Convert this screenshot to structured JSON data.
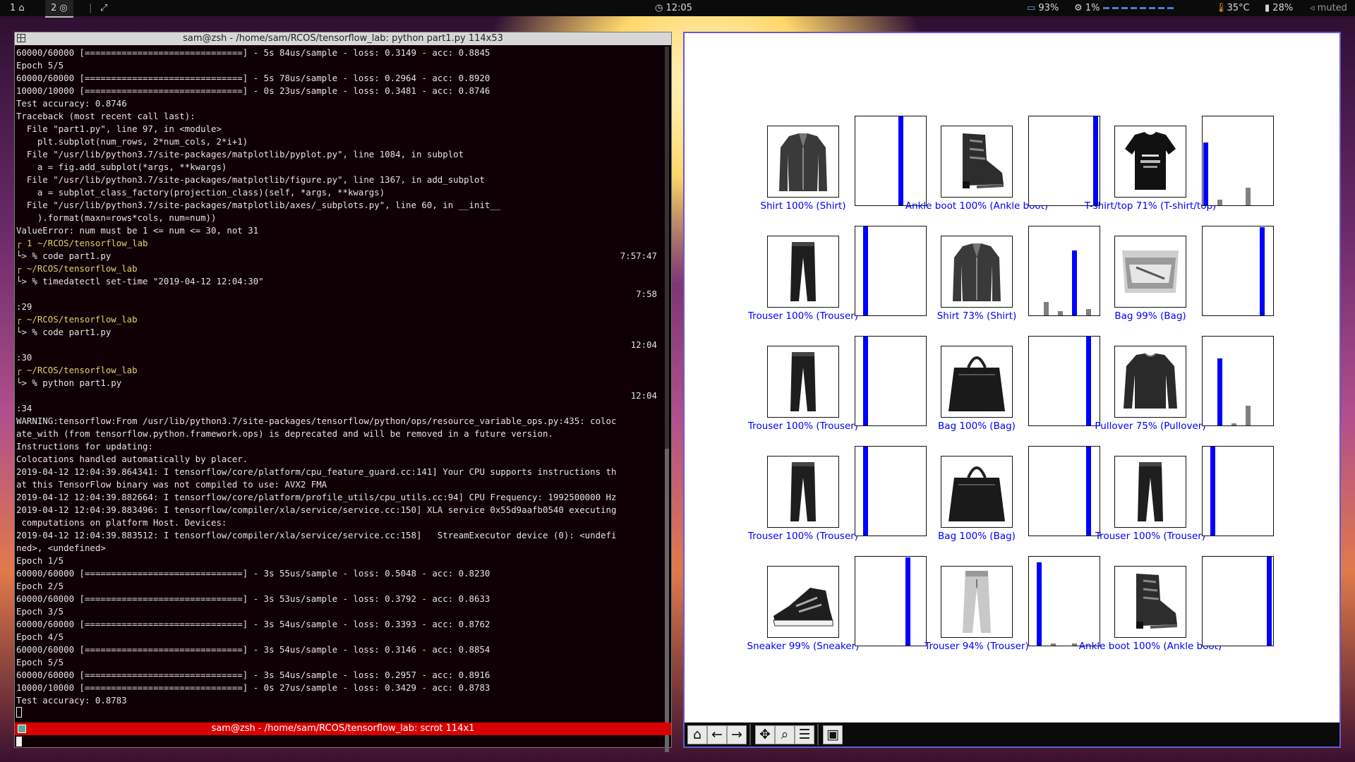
{
  "topbar": {
    "workspace1": "1",
    "workspace2": "2",
    "clock": "12:05",
    "battery": "93%",
    "cpu": "1%",
    "temp": "35°C",
    "brightness": "28%",
    "volume": "muted"
  },
  "terminal": {
    "title": "sam@zsh - /home/sam/RCOS/tensorflow_lab: python part1.py 114x53",
    "status_title": "sam@zsh - /home/sam/RCOS/tensorflow_lab: scrot 114x1",
    "lines": [
      {
        "t": "60000/60000 [==============================] - 5s 84us/sample - loss: 0.3149 - acc: 0.8845"
      },
      {
        "t": "Epoch 5/5"
      },
      {
        "t": "60000/60000 [==============================] - 5s 78us/sample - loss: 0.2964 - acc: 0.8920"
      },
      {
        "t": "10000/10000 [==============================] - 0s 23us/sample - loss: 0.3481 - acc: 0.8746"
      },
      {
        "t": "Test accuracy: 0.8746"
      },
      {
        "t": "Traceback (most recent call last):"
      },
      {
        "t": "  File \"part1.py\", line 97, in <module>"
      },
      {
        "t": "    plt.subplot(num_rows, 2*num_cols, 2*i+1)"
      },
      {
        "t": "  File \"/usr/lib/python3.7/site-packages/matplotlib/pyplot.py\", line 1084, in subplot"
      },
      {
        "t": "    a = fig.add_subplot(*args, **kwargs)"
      },
      {
        "t": "  File \"/usr/lib/python3.7/site-packages/matplotlib/figure.py\", line 1367, in add_subplot"
      },
      {
        "t": "    a = subplot_class_factory(projection_class)(self, *args, **kwargs)"
      },
      {
        "t": "  File \"/usr/lib/python3.7/site-packages/matplotlib/axes/_subplots.py\", line 60, in __init__"
      },
      {
        "t": "    ).format(maxn=rows*cols, num=num))"
      },
      {
        "t": "ValueError: num must be 1 <= num <= 30, not 31"
      },
      {
        "t": "┌ 1 ~/RCOS/tensorflow_lab",
        "dir": true
      },
      {
        "t": "└> % code part1.py",
        "r": "7:57:47"
      },
      {
        "t": "┌ ~/RCOS/tensorflow_lab",
        "dir": true
      },
      {
        "t": "└> % timedatectl set-time \"2019-04-12 12:04:30\""
      },
      {
        "t": "",
        "r": "7:58"
      },
      {
        "t": ":29"
      },
      {
        "t": "┌ ~/RCOS/tensorflow_lab",
        "dir": true
      },
      {
        "t": "└> % code part1.py"
      },
      {
        "t": "",
        "r": "12:04"
      },
      {
        "t": ":30"
      },
      {
        "t": "┌ ~/RCOS/tensorflow_lab",
        "dir": true
      },
      {
        "t": "└> % python part1.py"
      },
      {
        "t": "",
        "r": "12:04"
      },
      {
        "t": ":34"
      },
      {
        "t": "WARNING:tensorflow:From /usr/lib/python3.7/site-packages/tensorflow/python/ops/resource_variable_ops.py:435: coloc"
      },
      {
        "t": "ate_with (from tensorflow.python.framework.ops) is deprecated and will be removed in a future version."
      },
      {
        "t": "Instructions for updating:"
      },
      {
        "t": "Colocations handled automatically by placer."
      },
      {
        "t": "2019-04-12 12:04:39.864341: I tensorflow/core/platform/cpu_feature_guard.cc:141] Your CPU supports instructions th"
      },
      {
        "t": "at this TensorFlow binary was not compiled to use: AVX2 FMA"
      },
      {
        "t": "2019-04-12 12:04:39.882664: I tensorflow/core/platform/profile_utils/cpu_utils.cc:94] CPU Frequency: 1992500000 Hz"
      },
      {
        "t": "2019-04-12 12:04:39.883496: I tensorflow/compiler/xla/service/service.cc:150] XLA service 0x55d9aafb0540 executing"
      },
      {
        "t": " computations on platform Host. Devices:"
      },
      {
        "t": "2019-04-12 12:04:39.883512: I tensorflow/compiler/xla/service/service.cc:158]   StreamExecutor device (0): <undefi"
      },
      {
        "t": "ned>, <undefined>"
      },
      {
        "t": "Epoch 1/5"
      },
      {
        "t": "60000/60000 [==============================] - 3s 55us/sample - loss: 0.5048 - acc: 0.8230"
      },
      {
        "t": "Epoch 2/5"
      },
      {
        "t": "60000/60000 [==============================] - 3s 53us/sample - loss: 0.3792 - acc: 0.8633"
      },
      {
        "t": "Epoch 3/5"
      },
      {
        "t": "60000/60000 [==============================] - 3s 54us/sample - loss: 0.3393 - acc: 0.8762"
      },
      {
        "t": "Epoch 4/5"
      },
      {
        "t": "60000/60000 [==============================] - 3s 54us/sample - loss: 0.3146 - acc: 0.8854"
      },
      {
        "t": "Epoch 5/5"
      },
      {
        "t": "60000/60000 [==============================] - 3s 54us/sample - loss: 0.2957 - acc: 0.8916"
      },
      {
        "t": "10000/10000 [==============================] - 0s 27us/sample - loss: 0.3429 - acc: 0.8783"
      },
      {
        "t": "Test accuracy: 0.8783"
      }
    ]
  },
  "figure": {
    "toolbar": [
      {
        "name": "home-icon",
        "glyph": "⌂"
      },
      {
        "name": "back-icon",
        "glyph": "←"
      },
      {
        "name": "forward-icon",
        "glyph": "→"
      },
      {
        "name": "pan-icon",
        "glyph": "✥"
      },
      {
        "name": "zoom-icon",
        "glyph": "⌕"
      },
      {
        "name": "subplots-icon",
        "glyph": "☰"
      },
      {
        "name": "save-icon",
        "glyph": "▣"
      }
    ],
    "colors": {
      "predicted": "#0000ff",
      "other": "#808080",
      "caption": "#0000ff"
    },
    "panels": [
      {
        "caption": "Shirt 100% (Shirt)",
        "item": "shirt",
        "probs": [
          0,
          0,
          0,
          0,
          0,
          0,
          1,
          0,
          0,
          0
        ],
        "pred": 6
      },
      {
        "caption": "Ankle boot 100% (Ankle boot)",
        "item": "boot",
        "probs": [
          0,
          0,
          0,
          0,
          0,
          0,
          0,
          0,
          0,
          1
        ],
        "pred": 9
      },
      {
        "caption": "T-shirt/top 71% (T-shirt/top)",
        "item": "tshirt",
        "probs": [
          0.71,
          0,
          0.06,
          0,
          0,
          0,
          0.2,
          0,
          0,
          0
        ],
        "pred": 0
      },
      {
        "caption": "Trouser 100% (Trouser)",
        "item": "trouser",
        "probs": [
          0,
          1,
          0,
          0,
          0,
          0,
          0,
          0,
          0,
          0
        ],
        "pred": 1
      },
      {
        "caption": "Shirt 73% (Shirt)",
        "item": "shirt",
        "probs": [
          0,
          0,
          0.15,
          0,
          0.05,
          0,
          0.73,
          0,
          0.07,
          0
        ],
        "pred": 6
      },
      {
        "caption": "Bag 99% (Bag)",
        "item": "bag",
        "probs": [
          0,
          0,
          0,
          0,
          0,
          0,
          0,
          0,
          0.99,
          0
        ],
        "pred": 8
      },
      {
        "caption": "Trouser 100% (Trouser)",
        "item": "trouser",
        "probs": [
          0,
          1,
          0,
          0,
          0,
          0,
          0,
          0,
          0,
          0
        ],
        "pred": 1
      },
      {
        "caption": "Bag 100% (Bag)",
        "item": "tote",
        "probs": [
          0,
          0,
          0,
          0,
          0,
          0,
          0,
          0,
          1,
          0
        ],
        "pred": 8
      },
      {
        "caption": "Pullover 75% (Pullover)",
        "item": "pullover",
        "probs": [
          0,
          0,
          0.75,
          0,
          0.02,
          0,
          0.22,
          0,
          0,
          0
        ],
        "pred": 2
      },
      {
        "caption": "Trouser 100% (Trouser)",
        "item": "trouser",
        "probs": [
          0,
          1,
          0,
          0,
          0,
          0,
          0,
          0,
          0,
          0
        ],
        "pred": 1
      },
      {
        "caption": "Bag 100% (Bag)",
        "item": "tote",
        "probs": [
          0,
          0,
          0,
          0,
          0,
          0,
          0,
          0,
          1,
          0
        ],
        "pred": 8
      },
      {
        "caption": "Trouser 100% (Trouser)",
        "item": "trouser",
        "probs": [
          0,
          1,
          0,
          0,
          0,
          0,
          0,
          0,
          0,
          0
        ],
        "pred": 1
      },
      {
        "caption": "Sneaker 99% (Sneaker)",
        "item": "sneaker",
        "probs": [
          0,
          0,
          0,
          0,
          0,
          0,
          0,
          0.99,
          0,
          0
        ],
        "pred": 7
      },
      {
        "caption": "Trouser 94% (Trouser)",
        "item": "jeans",
        "probs": [
          0,
          0.94,
          0,
          0.02,
          0,
          0,
          0.02,
          0,
          0,
          0
        ],
        "pred": 1
      },
      {
        "caption": "Ankle boot 100% (Ankle boot)",
        "item": "boot",
        "probs": [
          0,
          0,
          0,
          0,
          0,
          0,
          0,
          0,
          0,
          1
        ],
        "pred": 9
      }
    ]
  }
}
